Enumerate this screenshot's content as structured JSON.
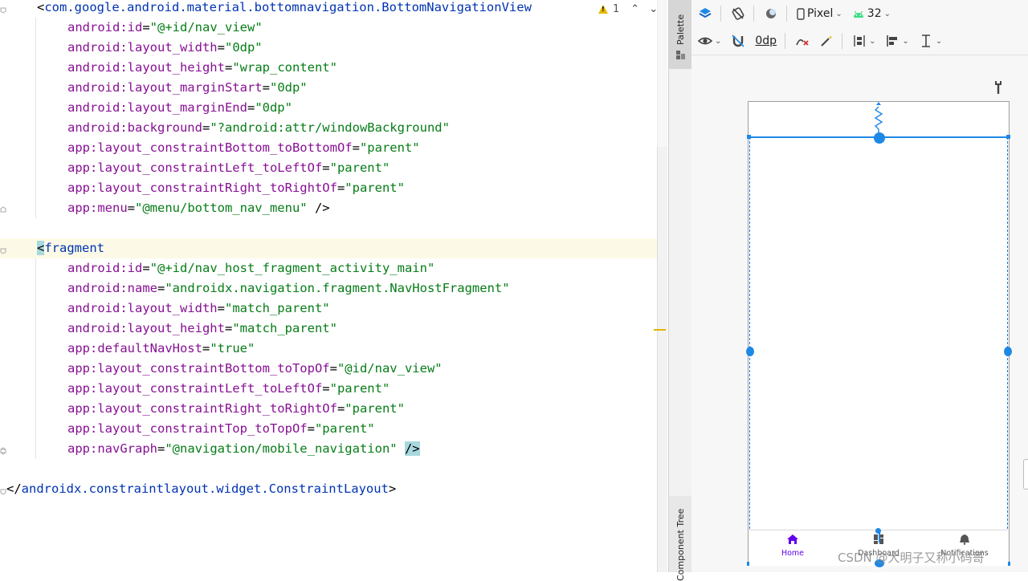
{
  "editor": {
    "warnings_count": "1",
    "lines": [
      {
        "indent": 0,
        "parts": [
          [
            "punct",
            "<"
          ],
          [
            "tag",
            "com.google.android.material.bottomnavigation.BottomNavigationView"
          ]
        ]
      },
      {
        "indent": 1,
        "parts": [
          [
            "ns",
            "android:"
          ],
          [
            "attr",
            "id"
          ],
          [
            "punct",
            "="
          ],
          [
            "val",
            "\"@+id/nav_view\""
          ]
        ]
      },
      {
        "indent": 1,
        "parts": [
          [
            "ns",
            "android:"
          ],
          [
            "attr",
            "layout_width"
          ],
          [
            "punct",
            "="
          ],
          [
            "val",
            "\"0dp\""
          ]
        ]
      },
      {
        "indent": 1,
        "parts": [
          [
            "ns",
            "android:"
          ],
          [
            "attr",
            "layout_height"
          ],
          [
            "punct",
            "="
          ],
          [
            "val",
            "\"wrap_content\""
          ]
        ]
      },
      {
        "indent": 1,
        "parts": [
          [
            "ns",
            "android:"
          ],
          [
            "attr",
            "layout_marginStart"
          ],
          [
            "punct",
            "="
          ],
          [
            "val",
            "\"0dp\""
          ]
        ]
      },
      {
        "indent": 1,
        "parts": [
          [
            "ns",
            "android:"
          ],
          [
            "attr",
            "layout_marginEnd"
          ],
          [
            "punct",
            "="
          ],
          [
            "val",
            "\"0dp\""
          ]
        ]
      },
      {
        "indent": 1,
        "parts": [
          [
            "ns",
            "android:"
          ],
          [
            "attr",
            "background"
          ],
          [
            "punct",
            "="
          ],
          [
            "val",
            "\"?android:attr/windowBackground\""
          ]
        ]
      },
      {
        "indent": 1,
        "parts": [
          [
            "ns",
            "app:"
          ],
          [
            "attr",
            "layout_constraintBottom_toBottomOf"
          ],
          [
            "punct",
            "="
          ],
          [
            "val",
            "\"parent\""
          ]
        ]
      },
      {
        "indent": 1,
        "parts": [
          [
            "ns",
            "app:"
          ],
          [
            "attr",
            "layout_constraintLeft_toLeftOf"
          ],
          [
            "punct",
            "="
          ],
          [
            "val",
            "\"parent\""
          ]
        ]
      },
      {
        "indent": 1,
        "parts": [
          [
            "ns",
            "app:"
          ],
          [
            "attr",
            "layout_constraintRight_toRightOf"
          ],
          [
            "punct",
            "="
          ],
          [
            "val",
            "\"parent\""
          ]
        ]
      },
      {
        "indent": 1,
        "parts": [
          [
            "ns",
            "app:"
          ],
          [
            "attr",
            "menu"
          ],
          [
            "punct",
            "="
          ],
          [
            "val",
            "\"@menu/bottom_nav_menu\""
          ],
          [
            "punct",
            " />"
          ]
        ]
      },
      {
        "indent": 0,
        "parts": []
      },
      {
        "indent": 0,
        "highlight": true,
        "parts": [
          [
            "punct",
            "<"
          ],
          [
            "tag",
            "fragment"
          ]
        ]
      },
      {
        "indent": 1,
        "parts": [
          [
            "ns",
            "android:"
          ],
          [
            "attr",
            "id"
          ],
          [
            "punct",
            "="
          ],
          [
            "val",
            "\"@+id/nav_host_fragment_activity_main\""
          ]
        ]
      },
      {
        "indent": 1,
        "parts": [
          [
            "ns",
            "android:"
          ],
          [
            "attr",
            "name"
          ],
          [
            "punct",
            "="
          ],
          [
            "val",
            "\"androidx.navigation.fragment.NavHostFragment\""
          ]
        ]
      },
      {
        "indent": 1,
        "parts": [
          [
            "ns",
            "android:"
          ],
          [
            "attr",
            "layout_width"
          ],
          [
            "punct",
            "="
          ],
          [
            "val",
            "\"match_parent\""
          ]
        ]
      },
      {
        "indent": 1,
        "parts": [
          [
            "ns",
            "android:"
          ],
          [
            "attr",
            "layout_height"
          ],
          [
            "punct",
            "="
          ],
          [
            "val",
            "\"match_parent\""
          ]
        ]
      },
      {
        "indent": 1,
        "parts": [
          [
            "ns",
            "app:"
          ],
          [
            "attr",
            "defaultNavHost"
          ],
          [
            "punct",
            "="
          ],
          [
            "val",
            "\"true\""
          ]
        ]
      },
      {
        "indent": 1,
        "parts": [
          [
            "ns",
            "app:"
          ],
          [
            "attr",
            "layout_constraintBottom_toTopOf"
          ],
          [
            "punct",
            "="
          ],
          [
            "val",
            "\"@id/nav_view\""
          ]
        ]
      },
      {
        "indent": 1,
        "parts": [
          [
            "ns",
            "app:"
          ],
          [
            "attr",
            "layout_constraintLeft_toLeftOf"
          ],
          [
            "punct",
            "="
          ],
          [
            "val",
            "\"parent\""
          ]
        ]
      },
      {
        "indent": 1,
        "parts": [
          [
            "ns",
            "app:"
          ],
          [
            "attr",
            "layout_constraintRight_toRightOf"
          ],
          [
            "punct",
            "="
          ],
          [
            "val",
            "\"parent\""
          ]
        ]
      },
      {
        "indent": 1,
        "parts": [
          [
            "ns",
            "app:"
          ],
          [
            "attr",
            "layout_constraintTop_toTopOf"
          ],
          [
            "punct",
            "="
          ],
          [
            "val",
            "\"parent\""
          ]
        ]
      },
      {
        "indent": 1,
        "parts": [
          [
            "ns",
            "app:"
          ],
          [
            "attr",
            "navGraph"
          ],
          [
            "punct",
            "="
          ],
          [
            "val",
            "\"@navigation/mobile_navigation\""
          ],
          [
            "punct",
            " "
          ],
          [
            "sel",
            "/>"
          ]
        ]
      },
      {
        "indent": 0,
        "parts": []
      },
      {
        "indent": -1,
        "parts": [
          [
            "punct",
            "</"
          ],
          [
            "tag",
            "androidx.constraintlayout.widget.ConstraintLayout"
          ],
          [
            "punct",
            ">"
          ]
        ]
      }
    ]
  },
  "side_tabs": {
    "palette": "Palette",
    "component_tree": "Component Tree"
  },
  "design_toolbar": {
    "device": "Pixel",
    "api_level": "32",
    "margin": "0dp"
  },
  "bottom_nav": {
    "items": [
      {
        "label": "Home",
        "color": "#6200ee"
      },
      {
        "label": "Dashboard",
        "color": "#555555"
      },
      {
        "label": "Notifications",
        "color": "#555555"
      }
    ]
  },
  "watermark": "CSDN @大明子又称小码哥",
  "colors": {
    "accent_blue": "#1e88e5",
    "primary": "#6200ee"
  }
}
